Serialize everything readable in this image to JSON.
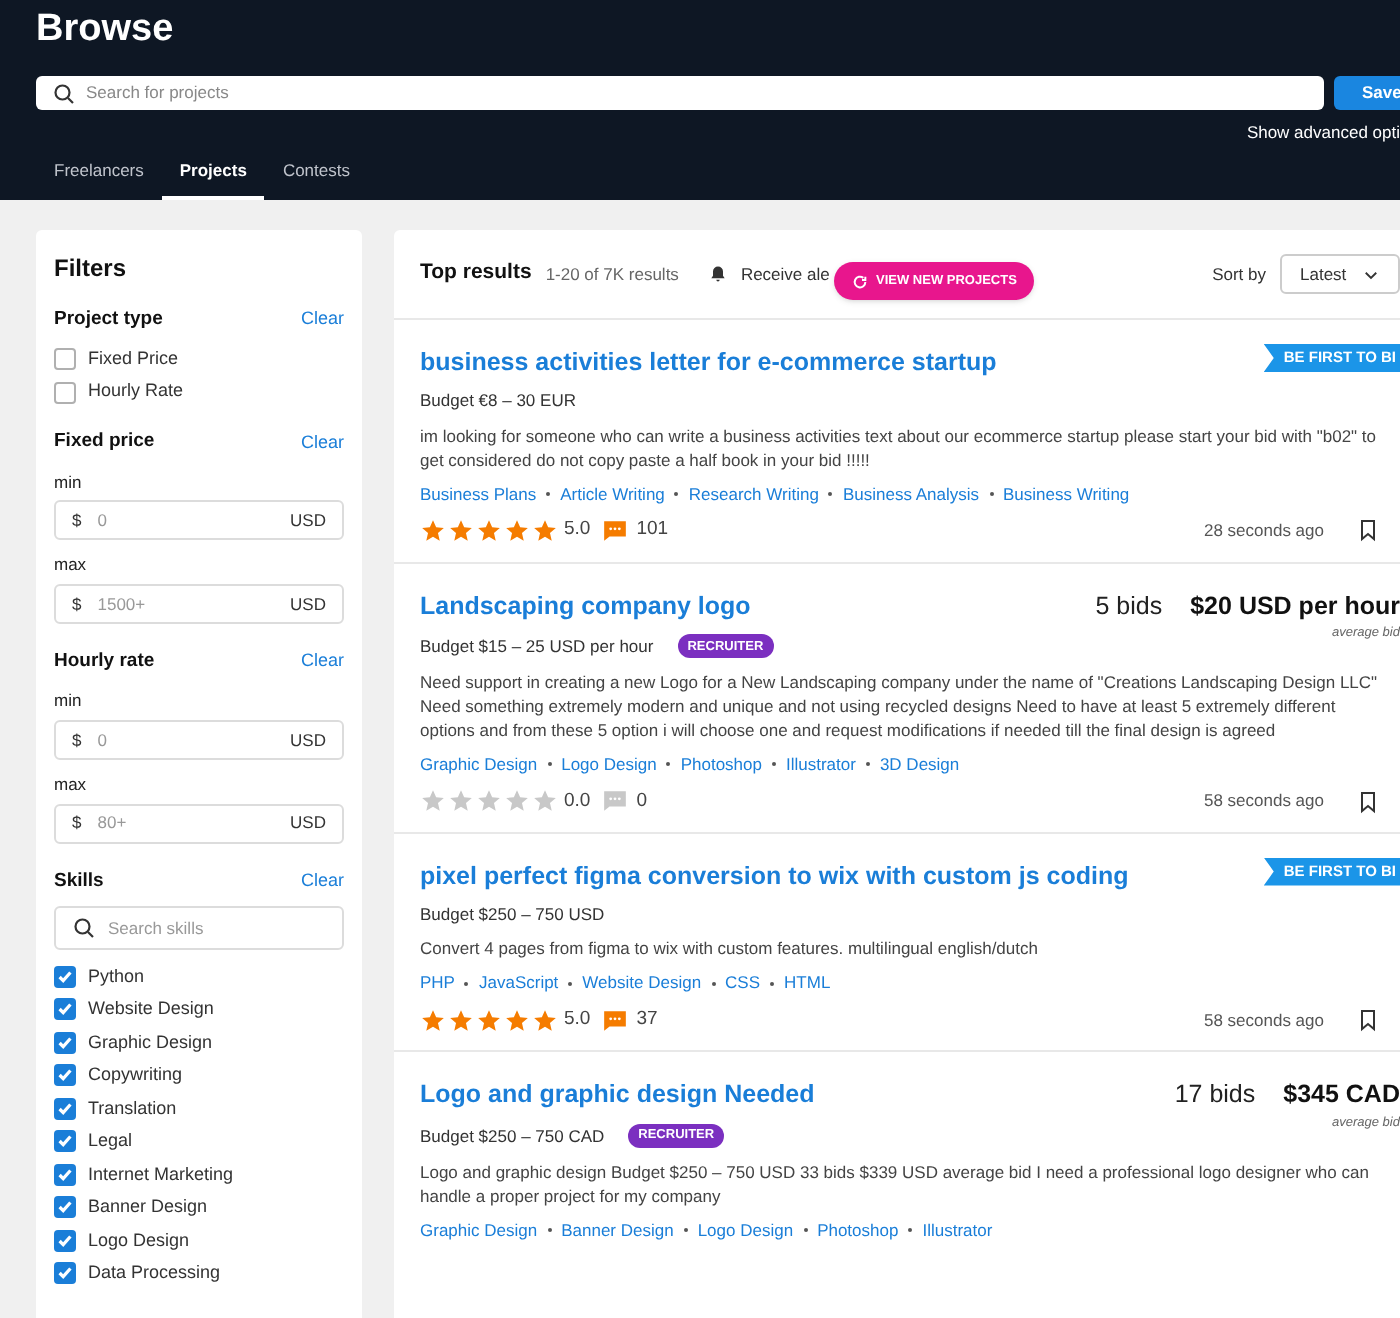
{
  "header": {
    "title": "Browse",
    "search_placeholder": "Search for projects",
    "save": "Save",
    "advanced": "Show advanced opti"
  },
  "tabs": [
    {
      "label": "Freelancers",
      "selected": false
    },
    {
      "label": "Projects",
      "selected": true
    },
    {
      "label": "Contests",
      "selected": false
    }
  ],
  "filters": {
    "title": "Filters",
    "project_type": {
      "title": "Project type",
      "clear": "Clear",
      "options": [
        {
          "label": "Fixed Price",
          "checked": false
        },
        {
          "label": "Hourly Rate",
          "checked": false
        }
      ]
    },
    "fixed_price": {
      "title": "Fixed price",
      "clear": "Clear",
      "fields": [
        {
          "label": "min",
          "prefix": "$",
          "placeholder": "0",
          "suffix": "USD"
        },
        {
          "label": "max",
          "prefix": "$",
          "placeholder": "1500+",
          "suffix": "USD"
        }
      ]
    },
    "hourly_rate": {
      "title": "Hourly rate",
      "clear": "Clear",
      "fields": [
        {
          "label": "min",
          "prefix": "$",
          "placeholder": "0",
          "suffix": "USD"
        },
        {
          "label": "max",
          "prefix": "$",
          "placeholder": "80+",
          "suffix": "USD"
        }
      ]
    },
    "skills": {
      "title": "Skills",
      "clear": "Clear",
      "search_placeholder": "Search skills",
      "options": [
        {
          "label": "Python",
          "checked": true
        },
        {
          "label": "Website Design",
          "checked": true
        },
        {
          "label": "Graphic Design",
          "checked": true
        },
        {
          "label": "Copywriting",
          "checked": true
        },
        {
          "label": "Translation",
          "checked": true
        },
        {
          "label": "Legal",
          "checked": true
        },
        {
          "label": "Internet Marketing",
          "checked": true
        },
        {
          "label": "Banner Design",
          "checked": true
        },
        {
          "label": "Logo Design",
          "checked": true
        },
        {
          "label": "Data Processing",
          "checked": true
        }
      ]
    }
  },
  "results": {
    "title": "Top results",
    "count": "1-20 of 7K results",
    "alert": "Receive ale",
    "new_projects": "VIEW NEW PROJECTS",
    "sort_label": "Sort by",
    "sort_value": "Latest",
    "projects": [
      {
        "title": "business activities letter for e-commerce startup",
        "ribbon": "BE FIRST TO BI",
        "budget": "Budget €8 – 30 EUR",
        "description": "im looking for someone who can write a business activities text about our ecommerce startup please start your bid with \"b02\" to get considered do not copy paste a half book in your bid !!!!!",
        "tags": [
          "Business Plans",
          "Article Writing",
          "Research Writing",
          "Business Analysis",
          "Business Writing"
        ],
        "stars": 5,
        "rating": "5.0",
        "reviews": "101",
        "time": "28 seconds ago"
      },
      {
        "title": "Landscaping company logo",
        "bids": "5 bids",
        "avg_bid": "$20 USD per hour",
        "avg_label": "average bid",
        "budget": "Budget $15 – 25 USD per hour",
        "badge": "RECRUITER",
        "description": "Need support in creating a new Logo for a New Landscaping company under the name of \"Creations Landscaping Design LLC\" Need something extremely modern and unique and not using recycled designs Need to have at least 5 extremely different options and from these 5 option i will choose one and request modifications if needed till the final design is agreed",
        "tags": [
          "Graphic Design",
          "Logo Design",
          "Photoshop",
          "Illustrator",
          "3D Design"
        ],
        "stars": 0,
        "rating": "0.0",
        "reviews": "0",
        "time": "58 seconds ago"
      },
      {
        "title": "pixel perfect figma conversion to wix with custom js coding",
        "ribbon": "BE FIRST TO BI",
        "budget": "Budget $250 – 750 USD",
        "description": "Convert 4 pages from figma to wix with custom features. multilingual english/dutch",
        "tags": [
          "PHP",
          "JavaScript",
          "Website Design",
          "CSS",
          "HTML"
        ],
        "stars": 5,
        "rating": "5.0",
        "reviews": "37",
        "time": "58 seconds ago"
      },
      {
        "title": "Logo and graphic design Needed",
        "bids": "17 bids",
        "avg_bid": "$345 CAD",
        "avg_label": "average bid",
        "budget": "Budget $250 – 750 CAD",
        "badge": "RECRUITER",
        "description": "Logo and graphic design Budget $250 – 750 USD 33 bids $339 USD average bid I need a professional logo designer who can handle a proper project for my company",
        "tags": [
          "Graphic Design",
          "Banner Design",
          "Logo Design",
          "Photoshop",
          "Illustrator"
        ]
      }
    ]
  }
}
